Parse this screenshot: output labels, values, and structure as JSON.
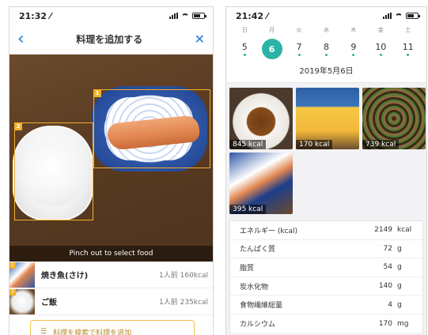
{
  "left": {
    "status": {
      "time": "21:32 ⁄"
    },
    "nav": {
      "title": "料理を追加する",
      "back_icon": "chevron-left-icon",
      "close_icon": "close-icon"
    },
    "photo": {
      "pinch_hint": "Pinch out to select food",
      "detections": [
        {
          "tag": "1"
        },
        {
          "tag": "2"
        }
      ]
    },
    "foods": [
      {
        "tag": "1",
        "name": "焼き魚(さけ)",
        "kcal": "1人前 160kcal"
      },
      {
        "tag": "2",
        "name": "ご飯",
        "kcal": "1人前 235kcal"
      }
    ],
    "add_button": {
      "label": "料理を検索で料理を追加"
    }
  },
  "right": {
    "status": {
      "time": "21:42 ⁄"
    },
    "calendar": {
      "weekdays": [
        "日",
        "月",
        "火",
        "水",
        "木",
        "金",
        "土"
      ],
      "days": [
        "5",
        "6",
        "7",
        "8",
        "9",
        "10",
        "11"
      ],
      "selected": "6",
      "date_label": "2019年5月6日"
    },
    "meals": [
      {
        "kcal": "845 kcal"
      },
      {
        "kcal": "170 kcal"
      },
      {
        "kcal": "739 kcal"
      },
      {
        "kcal": "395 kcal"
      }
    ],
    "nutrition": [
      {
        "label": "エネルギー (kcal)",
        "value": "2149",
        "unit": "kcal"
      },
      {
        "label": "たんぱく質",
        "value": "72",
        "unit": "g"
      },
      {
        "label": "脂質",
        "value": "54",
        "unit": "g"
      },
      {
        "label": "炭水化物",
        "value": "140",
        "unit": "g"
      },
      {
        "label": "食物繊維総量",
        "value": "4",
        "unit": "g"
      },
      {
        "label": "カルシウム",
        "value": "170",
        "unit": "mg"
      }
    ]
  },
  "colors": {
    "accent_blue": "#1f7ad6",
    "accent_teal": "#2bb3a7",
    "detect_orange": "#f2b12b"
  }
}
